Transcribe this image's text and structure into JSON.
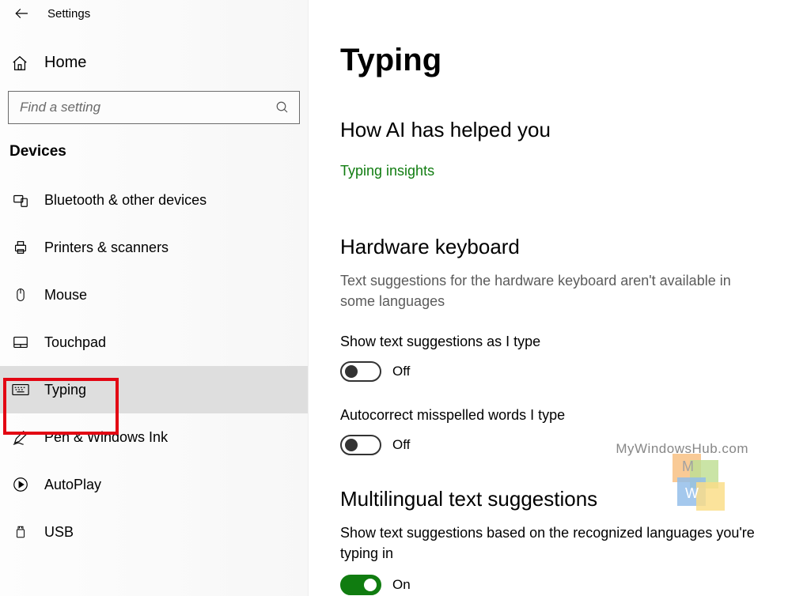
{
  "topbar": {
    "title": "Settings"
  },
  "sidebar": {
    "home_label": "Home",
    "search_placeholder": "Find a setting",
    "category": "Devices",
    "items": [
      {
        "label": "Bluetooth & other devices",
        "icon": "bluetooth-devices-icon",
        "selected": false
      },
      {
        "label": "Printers & scanners",
        "icon": "printer-icon",
        "selected": false
      },
      {
        "label": "Mouse",
        "icon": "mouse-icon",
        "selected": false
      },
      {
        "label": "Touchpad",
        "icon": "touchpad-icon",
        "selected": false
      },
      {
        "label": "Typing",
        "icon": "keyboard-icon",
        "selected": true
      },
      {
        "label": "Pen & Windows Ink",
        "icon": "pen-icon",
        "selected": false
      },
      {
        "label": "AutoPlay",
        "icon": "autoplay-icon",
        "selected": false
      },
      {
        "label": "USB",
        "icon": "usb-icon",
        "selected": false
      }
    ]
  },
  "main": {
    "title": "Typing",
    "ai_section": {
      "heading": "How AI has helped you",
      "link": "Typing insights"
    },
    "hardware": {
      "heading": "Hardware keyboard",
      "note": "Text suggestions for the hardware keyboard aren't available in some languages",
      "settings": [
        {
          "label": "Show text suggestions as I type",
          "on": false,
          "state": "Off"
        },
        {
          "label": "Autocorrect misspelled words I type",
          "on": false,
          "state": "Off"
        }
      ]
    },
    "multilingual": {
      "heading": "Multilingual text suggestions",
      "label": "Show text suggestions based on the recognized languages you're typing in",
      "on": true,
      "state": "On"
    }
  },
  "watermark_text": "MyWindowsHub.com"
}
